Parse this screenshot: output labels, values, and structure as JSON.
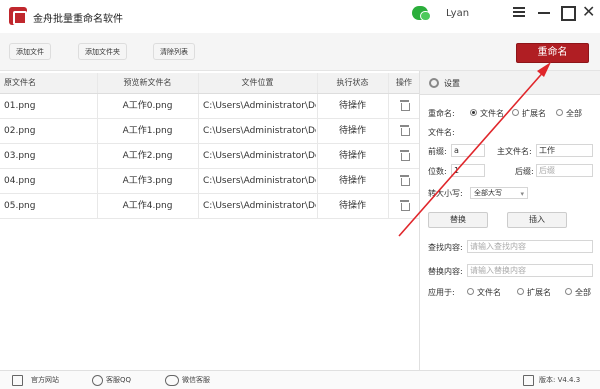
{
  "app": {
    "title": "金舟批量重命名软件",
    "username": "Lyan",
    "accent": "#b01e23"
  },
  "toolbar": {
    "add_file": "添加文件",
    "add_folder": "添加文件夹",
    "clear_list": "清除列表",
    "rename": "重命名"
  },
  "table": {
    "headers": [
      "原文件名",
      "预览新文件名",
      "文件位置",
      "执行状态",
      "操作"
    ],
    "rows": [
      {
        "name": "01.png",
        "preview": "A工作0.png",
        "path": "C:\\Users\\Administrator\\De...",
        "status": "待操作"
      },
      {
        "name": "02.png",
        "preview": "A工作1.png",
        "path": "C:\\Users\\Administrator\\De...",
        "status": "待操作"
      },
      {
        "name": "03.png",
        "preview": "A工作2.png",
        "path": "C:\\Users\\Administrator\\De...",
        "status": "待操作"
      },
      {
        "name": "04.png",
        "preview": "A工作3.png",
        "path": "C:\\Users\\Administrator\\De...",
        "status": "待操作"
      },
      {
        "name": "05.png",
        "preview": "A工作4.png",
        "path": "C:\\Users\\Administrator\\De...",
        "status": "待操作"
      }
    ]
  },
  "settings": {
    "title": "设置",
    "rename_label": "重命名:",
    "rename_options": [
      "文件名",
      "扩展名",
      "全部"
    ],
    "filename_label": "文件名:",
    "prefix_label": "前缀:",
    "prefix_value": "a",
    "main_name_label": "主文件名:",
    "main_name_value": "工作",
    "digits_label": "位数:",
    "digits_value": "1",
    "suffix_label": "后缀:",
    "suffix_placeholder": "后缀",
    "case_label": "转大小写:",
    "case_value": "全部大写",
    "replace_btn": "替换",
    "insert_btn": "插入",
    "find_label": "查找内容:",
    "find_placeholder": "请输入查找内容",
    "replace_label": "替换内容:",
    "replace_placeholder": "请输入替换内容",
    "apply_label": "应用于:",
    "apply_options": [
      "文件名",
      "扩展名",
      "全部"
    ]
  },
  "footer": {
    "website": "官方网站",
    "qq": "客服QQ",
    "wechat": "微信客服",
    "version": "版本: V4.4.3"
  }
}
